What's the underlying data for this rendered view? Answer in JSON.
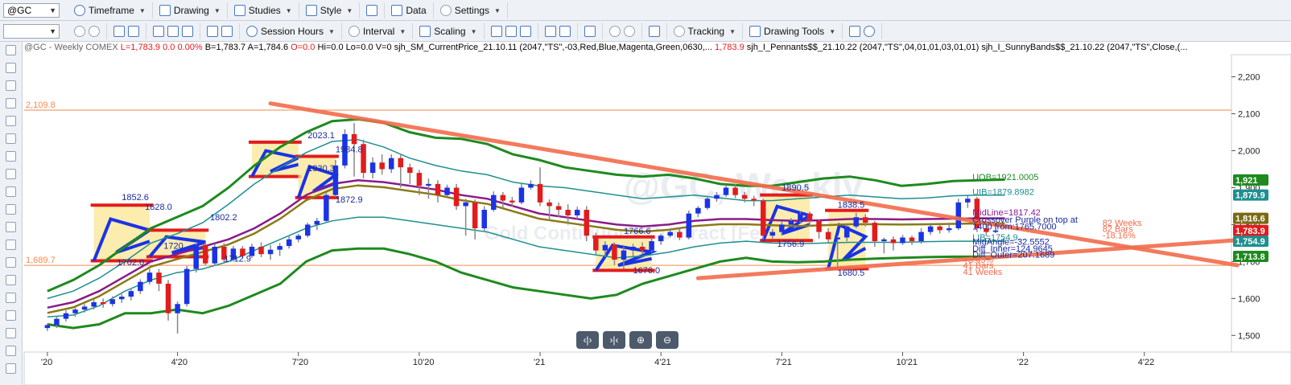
{
  "toolbar1": {
    "symbol": "@GC",
    "items": [
      {
        "name": "timeframe",
        "label": "Timeframe"
      },
      {
        "name": "drawing",
        "label": "Drawing"
      },
      {
        "name": "studies",
        "label": "Studies"
      },
      {
        "name": "style",
        "label": "Style"
      },
      {
        "name": "data",
        "label": "Data"
      },
      {
        "name": "settings",
        "label": "Settings"
      }
    ]
  },
  "toolbar2": {
    "interval_value": "",
    "items": [
      {
        "name": "session-hours",
        "label": "Session Hours"
      },
      {
        "name": "interval",
        "label": "Interval"
      },
      {
        "name": "scaling",
        "label": "Scaling"
      },
      {
        "name": "tracking",
        "label": "Tracking"
      },
      {
        "name": "drawing-tools",
        "label": "Drawing Tools"
      }
    ]
  },
  "infobar": {
    "symbol_desc": "@GC - Weekly  COMEX",
    "last": "L=1,783.9",
    "change": "0.0",
    "change_pct": "0.00%",
    "bid": "B=1,783.7",
    "ask": "A=1,784.6",
    "open": "O=0.0",
    "high": "Hi=0.0",
    "low": "Lo=0.0",
    "volume": "V=0",
    "study1": "sjh_SM_CurrentPrice_21.10.11 (2047,\"TS\",-03,Red,Blue,Magenta,Green,0630,...",
    "study1_value": "1,783.9",
    "study2": "sjh_I_Pennants$$_21.10.22 (2047,\"TS\",04,01,01,03,01,01)",
    "study3": "sjh_I_SunnyBands$$_21.10.22 (2047,\"TS\",Close,(..."
  },
  "chart_data": {
    "type": "candlestick",
    "watermark_line1": "@GC, Weekly",
    "watermark_line2": "Gold Continuous Contract [Feb22]",
    "ylim": [
      1455,
      2260
    ],
    "y_ticks": [
      "2,200",
      "2,100",
      "2,000",
      "1,900",
      "1,800",
      "1,700",
      "1,600",
      "1,500"
    ],
    "y_tick_values": [
      2200,
      2100,
      2000,
      1900,
      1800,
      1700,
      1600,
      1500
    ],
    "x_ticks": [
      "'20",
      "4'20",
      "7'20",
      "10'20",
      "'21",
      "4'21",
      "7'21",
      "10'21",
      "'22",
      "4'22"
    ],
    "x_tick_weeks": [
      0,
      14,
      27,
      40,
      53,
      66,
      79,
      92,
      105,
      118
    ],
    "horizontal_levels": [
      {
        "value": 2109.8,
        "label": "2,109.8",
        "color": "#f28b4b"
      },
      {
        "value": 1689.7,
        "label": "1,689.7",
        "color": "#f28b4b"
      }
    ],
    "price_badges": [
      {
        "label": "1,921",
        "value": 1921,
        "color": "#1e8a1e"
      },
      {
        "label": "1,879.9",
        "value": 1880,
        "color": "#1f8f8f"
      },
      {
        "label": "1,816.6",
        "value": 1817,
        "color": "#7a6a14"
      },
      {
        "label": "1,783.9",
        "value": 1784,
        "color": "#e21c1c"
      },
      {
        "label": "1,754.9",
        "value": 1755,
        "color": "#1f8f8f"
      },
      {
        "label": "1,713.8",
        "value": 1714,
        "color": "#1e8a1e"
      }
    ],
    "weeks": 130,
    "candles": [
      [
        1520,
        1528,
        1512,
        1532
      ],
      [
        1528,
        1545,
        1520,
        1552
      ],
      [
        1545,
        1560,
        1538,
        1568
      ],
      [
        1560,
        1570,
        1550,
        1578
      ],
      [
        1570,
        1578,
        1562,
        1585
      ],
      [
        1578,
        1590,
        1570,
        1598
      ],
      [
        1590,
        1585,
        1575,
        1600
      ],
      [
        1585,
        1598,
        1578,
        1606
      ],
      [
        1598,
        1605,
        1588,
        1612
      ],
      [
        1605,
        1620,
        1595,
        1628
      ],
      [
        1620,
        1645,
        1612,
        1652
      ],
      [
        1645,
        1670,
        1638,
        1680
      ],
      [
        1670,
        1640,
        1620,
        1680
      ],
      [
        1640,
        1560,
        1540,
        1650
      ],
      [
        1560,
        1585,
        1505,
        1592
      ],
      [
        1585,
        1680,
        1578,
        1688
      ],
      [
        1680,
        1745,
        1670,
        1750
      ],
      [
        1745,
        1695,
        1690,
        1752
      ],
      [
        1695,
        1740,
        1688,
        1748
      ],
      [
        1740,
        1705,
        1698,
        1750
      ],
      [
        1705,
        1735,
        1700,
        1742
      ],
      [
        1735,
        1715,
        1708,
        1742
      ],
      [
        1715,
        1740,
        1710,
        1748
      ],
      [
        1740,
        1720,
        1712,
        1752
      ],
      [
        1720,
        1732,
        1705,
        1745
      ],
      [
        1732,
        1742,
        1715,
        1750
      ],
      [
        1742,
        1760,
        1735,
        1768
      ],
      [
        1760,
        1770,
        1752,
        1775
      ],
      [
        1770,
        1800,
        1765,
        1805
      ],
      [
        1800,
        1810,
        1785,
        1818
      ],
      [
        1810,
        1880,
        1805,
        1888
      ],
      [
        1880,
        1960,
        1875,
        1975
      ],
      [
        1960,
        2045,
        1952,
        2058
      ],
      [
        2045,
        2018,
        1930,
        2075
      ],
      [
        2018,
        1940,
        1925,
        2030
      ],
      [
        1940,
        1968,
        1925,
        1982
      ],
      [
        1968,
        1950,
        1935,
        1990
      ],
      [
        1950,
        1980,
        1940,
        1990
      ],
      [
        1980,
        1955,
        1900,
        1988
      ],
      [
        1955,
        1940,
        1910,
        1965
      ],
      [
        1940,
        1905,
        1880,
        1948
      ],
      [
        1905,
        1910,
        1870,
        1925
      ],
      [
        1910,
        1880,
        1860,
        1920
      ],
      [
        1880,
        1900,
        1875,
        1908
      ],
      [
        1900,
        1850,
        1840,
        1910
      ],
      [
        1850,
        1860,
        1770,
        1870
      ],
      [
        1860,
        1790,
        1760,
        1868
      ],
      [
        1790,
        1840,
        1780,
        1850
      ],
      [
        1840,
        1880,
        1835,
        1890
      ],
      [
        1880,
        1865,
        1845,
        1888
      ],
      [
        1865,
        1860,
        1848,
        1875
      ],
      [
        1860,
        1900,
        1855,
        1910
      ],
      [
        1900,
        1910,
        1895,
        1920
      ],
      [
        1910,
        1860,
        1850,
        1955
      ],
      [
        1860,
        1850,
        1810,
        1868
      ],
      [
        1850,
        1840,
        1820,
        1860
      ],
      [
        1840,
        1825,
        1800,
        1855
      ],
      [
        1825,
        1840,
        1815,
        1848
      ],
      [
        1840,
        1770,
        1755,
        1850
      ],
      [
        1770,
        1730,
        1720,
        1778
      ],
      [
        1730,
        1745,
        1715,
        1755
      ],
      [
        1745,
        1705,
        1690,
        1752
      ],
      [
        1705,
        1730,
        1680,
        1740
      ],
      [
        1730,
        1740,
        1715,
        1748
      ],
      [
        1740,
        1730,
        1720,
        1752
      ],
      [
        1730,
        1755,
        1725,
        1762
      ],
      [
        1755,
        1770,
        1745,
        1775
      ],
      [
        1770,
        1780,
        1765,
        1790
      ],
      [
        1780,
        1765,
        1758,
        1790
      ],
      [
        1765,
        1830,
        1760,
        1838
      ],
      [
        1830,
        1845,
        1820,
        1850
      ],
      [
        1845,
        1870,
        1840,
        1878
      ],
      [
        1870,
        1880,
        1862,
        1888
      ],
      [
        1880,
        1900,
        1875,
        1908
      ],
      [
        1900,
        1880,
        1872,
        1910
      ],
      [
        1880,
        1870,
        1860,
        1888
      ],
      [
        1870,
        1865,
        1850,
        1878
      ],
      [
        1865,
        1770,
        1760,
        1870
      ],
      [
        1770,
        1780,
        1760,
        1788
      ],
      [
        1780,
        1800,
        1770,
        1808
      ],
      [
        1800,
        1810,
        1795,
        1818
      ],
      [
        1810,
        1830,
        1805,
        1835
      ],
      [
        1830,
        1810,
        1795,
        1835
      ],
      [
        1810,
        1780,
        1762,
        1815
      ],
      [
        1780,
        1760,
        1750,
        1790
      ],
      [
        1760,
        1765,
        1685,
        1770
      ],
      [
        1765,
        1795,
        1755,
        1800
      ],
      [
        1795,
        1820,
        1790,
        1832
      ],
      [
        1820,
        1805,
        1795,
        1828
      ],
      [
        1805,
        1755,
        1740,
        1810
      ],
      [
        1755,
        1760,
        1722,
        1765
      ],
      [
        1760,
        1750,
        1730,
        1768
      ],
      [
        1750,
        1765,
        1745,
        1772
      ],
      [
        1765,
        1755,
        1745,
        1770
      ],
      [
        1755,
        1780,
        1748,
        1790
      ],
      [
        1780,
        1795,
        1772,
        1800
      ],
      [
        1795,
        1785,
        1776,
        1802
      ],
      [
        1785,
        1790,
        1778,
        1805
      ],
      [
        1790,
        1860,
        1785,
        1870
      ],
      [
        1860,
        1870,
        1845,
        1878
      ],
      [
        1870,
        1790,
        1780,
        1875
      ],
      [
        1790,
        1780,
        1770,
        1805
      ],
      [
        1780,
        1784,
        1777,
        1790
      ]
    ],
    "bands": {
      "outer_upper": [
        1620,
        1650,
        1690,
        1740,
        1790,
        1820,
        1850,
        1900,
        1960,
        2010,
        2050,
        2080,
        2085,
        2075,
        2050,
        2035,
        2032,
        2018,
        1990,
        1975,
        1955,
        1945,
        1935,
        1930,
        1935,
        1925,
        1910,
        1905,
        1905,
        1915,
        1925,
        1930,
        1920,
        1905,
        1910,
        1918,
        1920,
        1922
      ],
      "inner_upper": [
        1600,
        1620,
        1655,
        1700,
        1750,
        1775,
        1805,
        1855,
        1910,
        1955,
        1995,
        2025,
        2030,
        2010,
        1980,
        1960,
        1945,
        1935,
        1915,
        1905,
        1900,
        1890,
        1880,
        1870,
        1875,
        1880,
        1872,
        1865,
        1865,
        1870,
        1875,
        1880,
        1875,
        1870,
        1872,
        1878,
        1880,
        1880
      ],
      "midline": [
        1575,
        1590,
        1620,
        1660,
        1700,
        1720,
        1740,
        1760,
        1790,
        1830,
        1880,
        1910,
        1920,
        1915,
        1905,
        1895,
        1880,
        1870,
        1850,
        1830,
        1820,
        1810,
        1800,
        1795,
        1800,
        1810,
        1815,
        1815,
        1812,
        1810,
        1812,
        1815,
        1815,
        1814,
        1815,
        1816,
        1817,
        1817
      ],
      "inner_lower": [
        1550,
        1555,
        1580,
        1620,
        1650,
        1670,
        1680,
        1700,
        1730,
        1760,
        1790,
        1810,
        1820,
        1820,
        1810,
        1800,
        1790,
        1780,
        1760,
        1740,
        1730,
        1720,
        1710,
        1715,
        1725,
        1740,
        1750,
        1755,
        1750,
        1748,
        1750,
        1752,
        1752,
        1752,
        1754,
        1755,
        1755,
        1755
      ],
      "outer_lower": [
        1530,
        1520,
        1530,
        1560,
        1560,
        1570,
        1560,
        1580,
        1610,
        1640,
        1700,
        1730,
        1735,
        1735,
        1720,
        1700,
        1670,
        1650,
        1630,
        1620,
        1610,
        1600,
        1610,
        1640,
        1660,
        1680,
        1700,
        1710,
        1700,
        1698,
        1700,
        1705,
        1708,
        1710,
        1712,
        1713,
        1713,
        1714
      ]
    },
    "pennant_lines": [
      {
        "from": [
          24,
          2128
        ],
        "to": [
          128,
          1690
        ]
      },
      {
        "from": [
          70,
          1655
        ],
        "to": [
          128,
          1758
        ]
      }
    ],
    "pennant_boxes": [
      {
        "w1": 5,
        "w2": 11,
        "top": 1852.6,
        "bottom": 1702.0
      },
      {
        "w1": 11,
        "w2": 17,
        "top": 1785,
        "bottom": 1712.9
      },
      {
        "w1": 22,
        "w2": 27,
        "top": 2023.1,
        "bottom": 1930.0
      },
      {
        "w1": 27,
        "w2": 31,
        "top": 1984.8,
        "bottom": 1872.9
      },
      {
        "w1": 59,
        "w2": 65,
        "top": 1766.6,
        "bottom": 1676.0
      },
      {
        "w1": 77,
        "w2": 82,
        "top": 1880,
        "bottom": 1756.9
      },
      {
        "w1": 84,
        "w2": 88,
        "top": 1838.5,
        "bottom": 1680.5
      }
    ],
    "price_labels": [
      {
        "text": "1852.6",
        "w": 8,
        "v": 1866
      },
      {
        "text": "1828.0",
        "w": 10.5,
        "v": 1840
      },
      {
        "text": "1802.2",
        "w": 17.5,
        "v": 1812
      },
      {
        "text": "1702.0",
        "w": 7.5,
        "v": 1690
      },
      {
        "text": "1712.9",
        "w": 19,
        "v": 1700
      },
      {
        "text": "1720",
        "w": 12.5,
        "v": 1735
      },
      {
        "text": "2023.1",
        "w": 28,
        "v": 2034
      },
      {
        "text": "1984.8",
        "w": 31,
        "v": 1996
      },
      {
        "text": "1930.3",
        "w": 28,
        "v": 1945
      },
      {
        "text": "1872.9",
        "w": 31,
        "v": 1860
      },
      {
        "text": "1766.6",
        "w": 62,
        "v": 1775
      },
      {
        "text": "1676.0",
        "w": 63,
        "v": 1668
      },
      {
        "text": "1890.5",
        "w": 79,
        "v": 1892
      },
      {
        "text": "1756.9",
        "w": 78.5,
        "v": 1740
      },
      {
        "text": "1838.5",
        "w": 85,
        "v": 1846
      },
      {
        "text": "1680.5",
        "w": 85,
        "v": 1662
      }
    ],
    "annotations": [
      {
        "text": "UOB=1921.0005",
        "color": "#1e8a1e",
        "w": 99.5,
        "v": 1921
      },
      {
        "text": "UIB=1879.8982",
        "color": "#1f8f8f",
        "w": 99.5,
        "v": 1880
      },
      {
        "text": "MidLine=1817.42",
        "color": "#8a1b8a",
        "w": 99.5,
        "v": 1825
      },
      {
        "text": "Crossover Purple on top at",
        "color": "#1a2a9a",
        "w": 99.5,
        "v": 1805
      },
      {
        "text": "1400 from:1765.7000",
        "color": "#1a2a9a",
        "w": 99.5,
        "v": 1787
      },
      {
        "text": "LIB=1754.9...",
        "color": "#1f8f8f",
        "w": 99.5,
        "v": 1757
      },
      {
        "text": "MidAngle=-32.5552",
        "color": "#1a2a9a",
        "w": 99.5,
        "v": 1745
      },
      {
        "text": "Diff_Inner=124.9645",
        "color": "#1a2a9a",
        "w": 99.5,
        "v": 1727
      },
      {
        "text": "Diff_Outer=207.1689",
        "color": "#1a2a9a",
        "w": 99.5,
        "v": 1711
      },
      {
        "text": "82 Weeks",
        "color": "#f26b4b",
        "w": 113.5,
        "v": 1797
      },
      {
        "text": "82 Bars",
        "color": "#f26b4b",
        "w": 113.5,
        "v": 1780
      },
      {
        "text": "-18.16%",
        "color": "#f26b4b",
        "w": 113.5,
        "v": 1763
      },
      {
        "text": "+3.43%",
        "color": "#f26b4b",
        "w": 98.5,
        "v": 1697
      },
      {
        "text": "41 Bars",
        "color": "#f26b4b",
        "w": 98.5,
        "v": 1681
      },
      {
        "text": "41 Weeks",
        "color": "#f26b4b",
        "w": 98.5,
        "v": 1664
      }
    ]
  }
}
